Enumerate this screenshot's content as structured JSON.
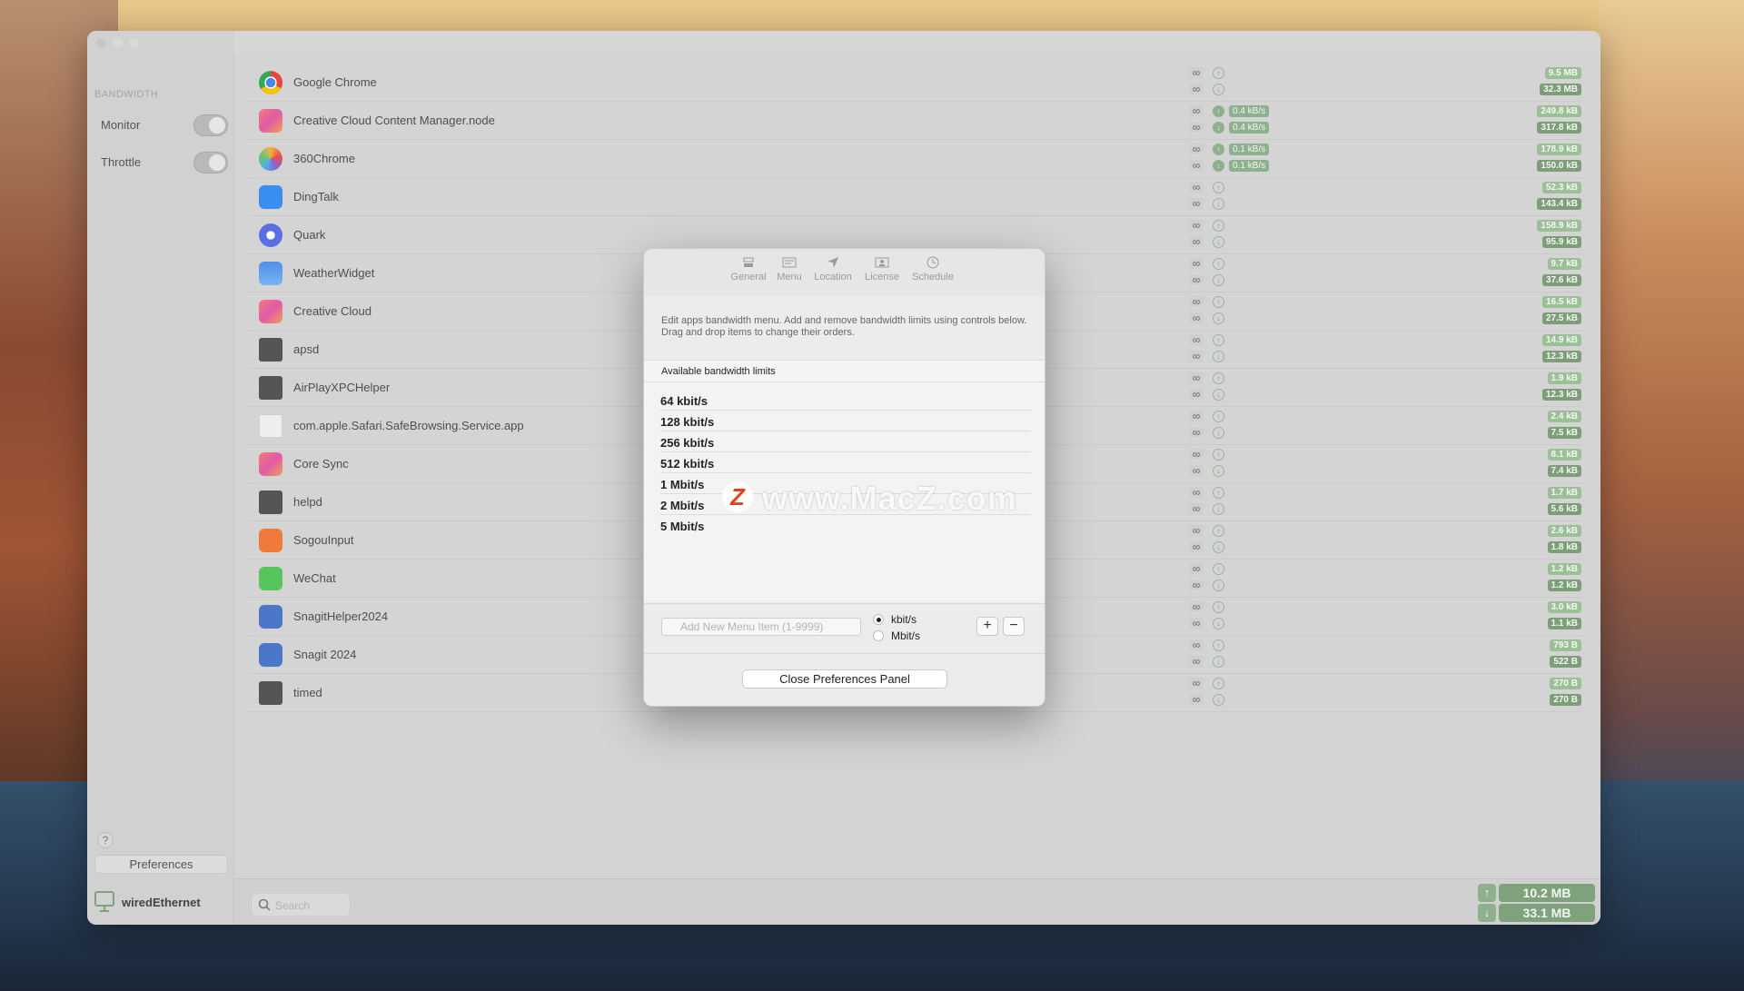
{
  "sidebar": {
    "header": "BANDWIDTH",
    "items": [
      {
        "label": "Monitor"
      },
      {
        "label": "Throttle"
      }
    ],
    "help": "?",
    "preferences_label": "Preferences",
    "network_label": "wiredEthernet"
  },
  "apps": [
    {
      "name": "Google Chrome",
      "icon": "chrome-icon",
      "up_rate": "",
      "down_rate": "",
      "up_total": "9.5 MB",
      "down_total": "32.3 MB"
    },
    {
      "name": "Creative Cloud Content Manager.node",
      "icon": "creative-cloud-icon",
      "up_rate": "0.4 kB/s",
      "down_rate": "0.4 kB/s",
      "up_total": "249.8 kB",
      "down_total": "317.8 kB"
    },
    {
      "name": "360Chrome",
      "icon": "360chrome-icon",
      "up_rate": "0.1 kB/s",
      "down_rate": "0.1 kB/s",
      "up_total": "178.9 kB",
      "down_total": "150.0 kB"
    },
    {
      "name": "DingTalk",
      "icon": "dingtalk-icon",
      "up_rate": "",
      "down_rate": "",
      "up_total": "52.3 kB",
      "down_total": "143.4 kB"
    },
    {
      "name": "Quark",
      "icon": "quark-icon",
      "up_rate": "",
      "down_rate": "",
      "up_total": "158.9 kB",
      "down_total": "95.9 kB"
    },
    {
      "name": "WeatherWidget",
      "icon": "weather-icon",
      "up_rate": "",
      "down_rate": "",
      "up_total": "9.7 kB",
      "down_total": "37.6 kB"
    },
    {
      "name": "Creative Cloud",
      "icon": "creative-cloud-icon",
      "up_rate": "",
      "down_rate": "",
      "up_total": "16.5 kB",
      "down_total": "27.5 kB"
    },
    {
      "name": "apsd",
      "icon": "terminal-icon",
      "up_rate": "",
      "down_rate": "",
      "up_total": "14.9 kB",
      "down_total": "12.3 kB"
    },
    {
      "name": "AirPlayXPCHelper",
      "icon": "terminal-icon",
      "up_rate": "",
      "down_rate": "",
      "up_total": "1.9 kB",
      "down_total": "12.3 kB"
    },
    {
      "name": "com.apple.Safari.SafeBrowsing.Service.app",
      "icon": "document-icon",
      "up_rate": "",
      "down_rate": "",
      "up_total": "2.4 kB",
      "down_total": "7.5 kB"
    },
    {
      "name": "Core Sync",
      "icon": "creative-cloud-icon",
      "up_rate": "",
      "down_rate": "",
      "up_total": "8.1 kB",
      "down_total": "7.4 kB"
    },
    {
      "name": "helpd",
      "icon": "terminal-icon",
      "up_rate": "",
      "down_rate": "",
      "up_total": "1.7 kB",
      "down_total": "5.6 kB"
    },
    {
      "name": "SogouInput",
      "icon": "sogou-icon",
      "up_rate": "",
      "down_rate": "",
      "up_total": "2.6 kB",
      "down_total": "1.8 kB"
    },
    {
      "name": "WeChat",
      "icon": "wechat-icon",
      "up_rate": "",
      "down_rate": "",
      "up_total": "1.2 kB",
      "down_total": "1.2 kB"
    },
    {
      "name": "SnagitHelper2024",
      "icon": "snagit-icon",
      "up_rate": "",
      "down_rate": "",
      "up_total": "3.0 kB",
      "down_total": "1.1 kB"
    },
    {
      "name": "Snagit 2024",
      "icon": "snagit-icon",
      "up_rate": "",
      "down_rate": "",
      "up_total": "793 B",
      "down_total": "522 B"
    },
    {
      "name": "timed",
      "icon": "terminal-icon",
      "up_rate": "",
      "down_rate": "",
      "up_total": "270 B",
      "down_total": "270 B"
    }
  ],
  "infinity_symbol": "∞",
  "bottom": {
    "search_placeholder": "Search",
    "total_up": "10.2 MB",
    "total_down": "33.1 MB"
  },
  "dialog": {
    "tabs": [
      {
        "label": "General",
        "icon": "general-icon"
      },
      {
        "label": "Menu",
        "icon": "menu-icon"
      },
      {
        "label": "Location",
        "icon": "location-icon"
      },
      {
        "label": "License",
        "icon": "license-icon"
      },
      {
        "label": "Schedule",
        "icon": "schedule-icon"
      }
    ],
    "description": "Edit apps bandwidth menu. Add and remove bandwidth limits using controls below. Drag and drop items to change their orders.",
    "section_title": "Available bandwidth limits",
    "limits": [
      "64 kbit/s",
      "128 kbit/s",
      "256 kbit/s",
      "512 kbit/s",
      "1 Mbit/s",
      "2 Mbit/s",
      "5 Mbit/s"
    ],
    "new_item_placeholder": "Add New Menu Item (1-9999)",
    "unit_options": [
      {
        "label": "kbit/s",
        "selected": true
      },
      {
        "label": "Mbit/s",
        "selected": false
      }
    ],
    "add_label": "+",
    "remove_label": "−",
    "close_label": "Close Preferences Panel"
  },
  "watermark": {
    "logo": "Z",
    "text": "www.MacZ.com"
  },
  "colors": {
    "rate_green": "#8fb08f",
    "total_green": "#7fa17c"
  }
}
